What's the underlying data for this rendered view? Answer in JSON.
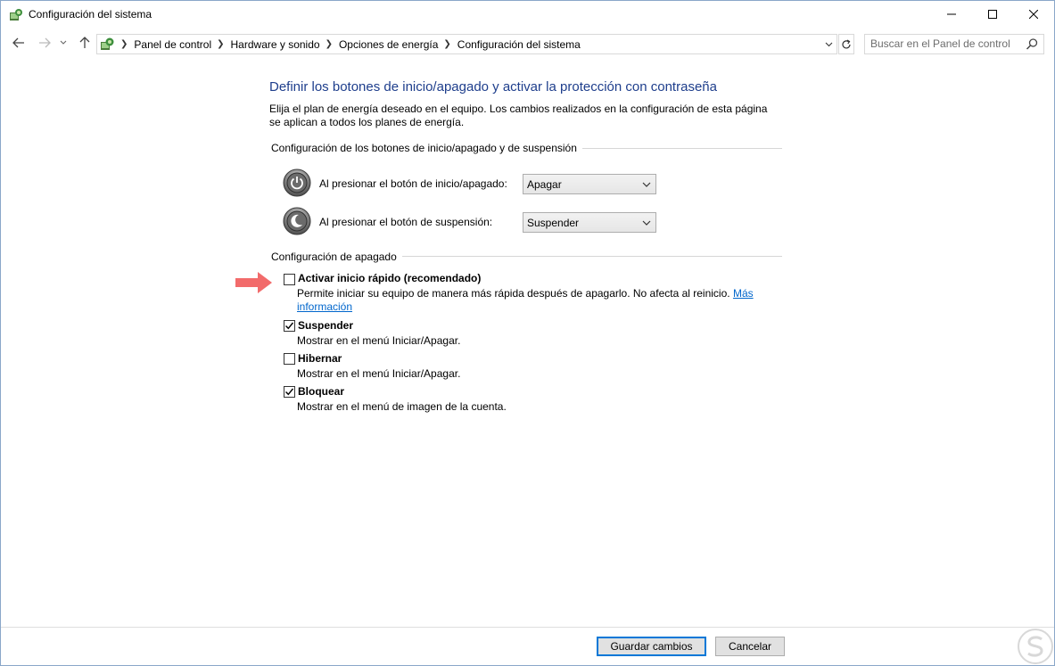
{
  "window": {
    "title": "Configuración del sistema"
  },
  "address_bar": {
    "breadcrumbs": [
      "Panel de control",
      "Hardware y sonido",
      "Opciones de energía",
      "Configuración del sistema"
    ]
  },
  "search": {
    "placeholder": "Buscar en el Panel de control"
  },
  "main": {
    "heading": "Definir los botones de inicio/apagado y activar la protección con contraseña",
    "description": "Elija el plan de energía deseado en el equipo. Los cambios realizados en la configuración de esta página se aplican a todos los planes de energía.",
    "buttons_section": {
      "title": "Configuración de los botones de inicio/apagado y de suspensión",
      "power_label": "Al presionar el botón de inicio/apagado:",
      "power_value": "Apagar",
      "sleep_label": "Al presionar el botón de suspensión:",
      "sleep_value": "Suspender"
    },
    "shutdown_section": {
      "title": "Configuración de apagado",
      "options": [
        {
          "label": "Activar inicio rápido (recomendado)",
          "desc": "Permite iniciar su equipo de manera más rápida después de apagarlo. No afecta al reinicio.",
          "link_1": "Más",
          "link_2": "información",
          "checked": false
        },
        {
          "label": "Suspender",
          "desc": "Mostrar en el menú Iniciar/Apagar.",
          "checked": true
        },
        {
          "label": "Hibernar",
          "desc": "Mostrar en el menú Iniciar/Apagar.",
          "checked": false
        },
        {
          "label": "Bloquear",
          "desc": "Mostrar en el menú de imagen de la cuenta.",
          "checked": true
        }
      ]
    }
  },
  "footer": {
    "save_label": "Guardar cambios",
    "cancel_label": "Cancelar"
  },
  "colors": {
    "heading": "#1e3e8c",
    "link": "#0066cc",
    "annotation_arrow": "#f26b6b"
  }
}
